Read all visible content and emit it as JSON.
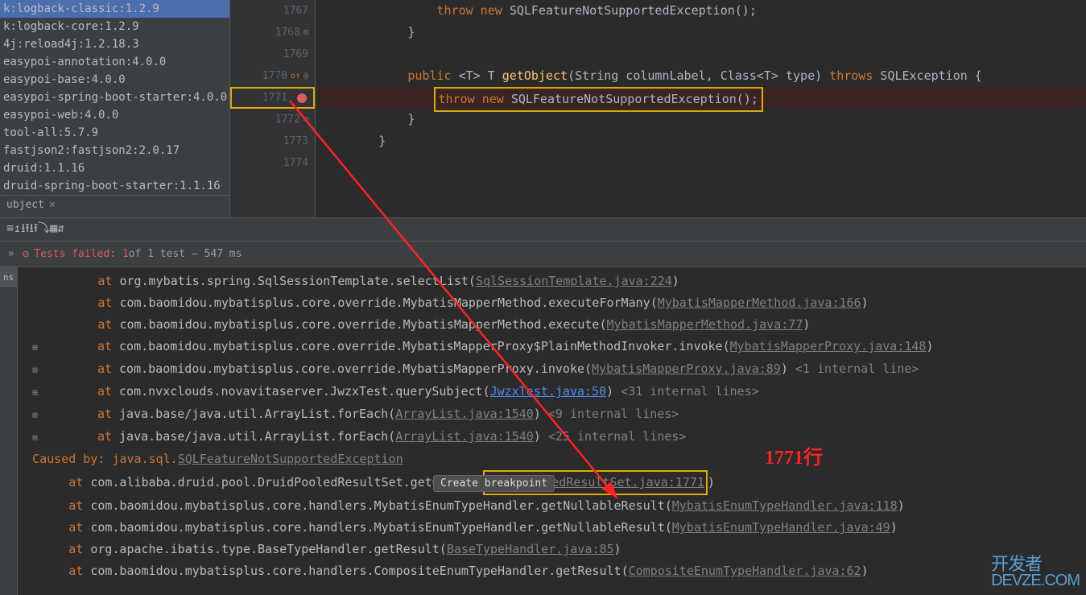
{
  "sidebar": {
    "items": [
      "k:logback-classic:1.2.9",
      "k:logback-core:1.2.9",
      "4j:reload4j:1.2.18.3",
      "easypoi-annotation:4.0.0",
      "easypoi-base:4.0.0",
      "easypoi-spring-boot-starter:4.0.0",
      "easypoi-web:4.0.0",
      "tool-all:5.7.9",
      "fastjson2:fastjson2:2.0.17",
      "druid:1.1.16",
      "druid-spring-boot-starter:1.1.16"
    ],
    "tab": "ubject",
    "close": "×"
  },
  "editor": {
    "lines": {
      "1767": {
        "keyword": "throw new ",
        "cls": "SQLFeatureNotSupportedException",
        "tail": "();"
      },
      "1768": {
        "brace": "}"
      },
      "1769": {
        "empty": true
      },
      "1770": {
        "sig_pre": "public ",
        "sig_generic": "<T> T ",
        "fn": "getObject",
        "params": "(String columnLabel, Class<T> type) ",
        "throws": "throws ",
        "exc": "SQLException {"
      },
      "1771": {
        "keyword": "throw ",
        "new": "new ",
        "cls": "SQLFeatureNotSupportedException",
        "tail": "();"
      },
      "1772": {
        "brace": "}"
      },
      "1773": {
        "brace": "}"
      },
      "1774": {
        "empty": true
      }
    }
  },
  "test": {
    "chev": "»",
    "label": "Tests failed:",
    "count": "1",
    "of": " of 1 test – 547 ms"
  },
  "stack": [
    {
      "type": "at",
      "indent": "        ",
      "pkg": "org.mybatis.spring.SqlSessionTemplate.selectList",
      "lnk": "SqlSessionTemplate.java:224",
      "g": true
    },
    {
      "type": "at",
      "indent": "        ",
      "pkg": "com.baomidou.mybatisplus.core.override.MybatisMapperMethod.executeForMany",
      "lnk": "MybatisMapperMethod.java:166",
      "g": true
    },
    {
      "type": "at",
      "indent": "        ",
      "pkg": "com.baomidou.mybatisplus.core.override.MybatisMapperMethod.execute",
      "lnk": "MybatisMapperMethod.java:77",
      "g": true
    },
    {
      "type": "at",
      "indent": "        ",
      "expand": "⊞",
      "pkg": "com.baomidou.mybatisplus.core.override.MybatisMapperProxy$PlainMethodInvoker.invoke",
      "lnk": "MybatisMapperProxy.java:148",
      "g": true
    },
    {
      "type": "at",
      "indent": "        ",
      "expand": "⊞",
      "pkg": "com.baomidou.mybatisplus.core.override.MybatisMapperProxy.invoke",
      "lnk": "MybatisMapperProxy.java:89",
      "g": true,
      "note": " <1 internal line>"
    },
    {
      "type": "at",
      "indent": "        ",
      "expand": "⊞",
      "pkg": "com.nvxclouds.novavitaserver.JwzxTest.querySubject",
      "lnk": "JwzxTest.java:50",
      "g": false,
      "note": " <31 internal lines>"
    },
    {
      "type": "at",
      "indent": "        ",
      "expand": "⊞",
      "pkg": "java.base/java.util.ArrayList.forEach",
      "lnk": "ArrayList.java:1540",
      "g": true,
      "note": " <9 internal lines>"
    },
    {
      "type": "at",
      "indent": "        ",
      "expand": "⊞",
      "pkg": "java.base/java.util.ArrayList.forEach",
      "lnk": "ArrayList.java:1540",
      "g": true,
      "note": " <25 internal lines>"
    },
    {
      "type": "caused",
      "text": "Caused by: java.sql.",
      "lnk": "SQLFeatureNotSupportedException",
      "tip": "Create breakpoint"
    },
    {
      "type": "at",
      "indent": "    ",
      "pkg": "com.alibaba.druid.pool.DruidPooledResultSet.getObject",
      "lnk": "DruidPooledResultSet.java:1771",
      "g": true,
      "boxed": true
    },
    {
      "type": "at",
      "indent": "    ",
      "pkg": "com.baomidou.mybatisplus.core.handlers.MybatisEnumTypeHandler.getNullableResult",
      "lnk": "MybatisEnumTypeHandler.java:118",
      "g": true
    },
    {
      "type": "at",
      "indent": "    ",
      "pkg": "com.baomidou.mybatisplus.core.handlers.MybatisEnumTypeHandler.getNullableResult",
      "lnk": "MybatisEnumTypeHandler.java:49",
      "g": true
    },
    {
      "type": "at",
      "indent": "    ",
      "pkg": "org.apache.ibatis.type.BaseTypeHandler.getResult",
      "lnk": "BaseTypeHandler.java:85",
      "g": true
    },
    {
      "type": "at",
      "indent": "    ",
      "pkg": "com.baomidou.mybatisplus.core.handlers.CompositeEnumTypeHandler.getResult",
      "lnk": "CompositeEnumTypeHandler.java:62",
      "g": true
    }
  ],
  "annotation": {
    "text": "1771行"
  },
  "watermark": {
    "top": "开发者",
    "bot": "DEVZE.COM"
  },
  "toolbar_icons": [
    "≡",
    "↥",
    "⭳",
    "⭱",
    "⭳",
    "⭱",
    "⤵",
    "▦",
    "⇵"
  ]
}
